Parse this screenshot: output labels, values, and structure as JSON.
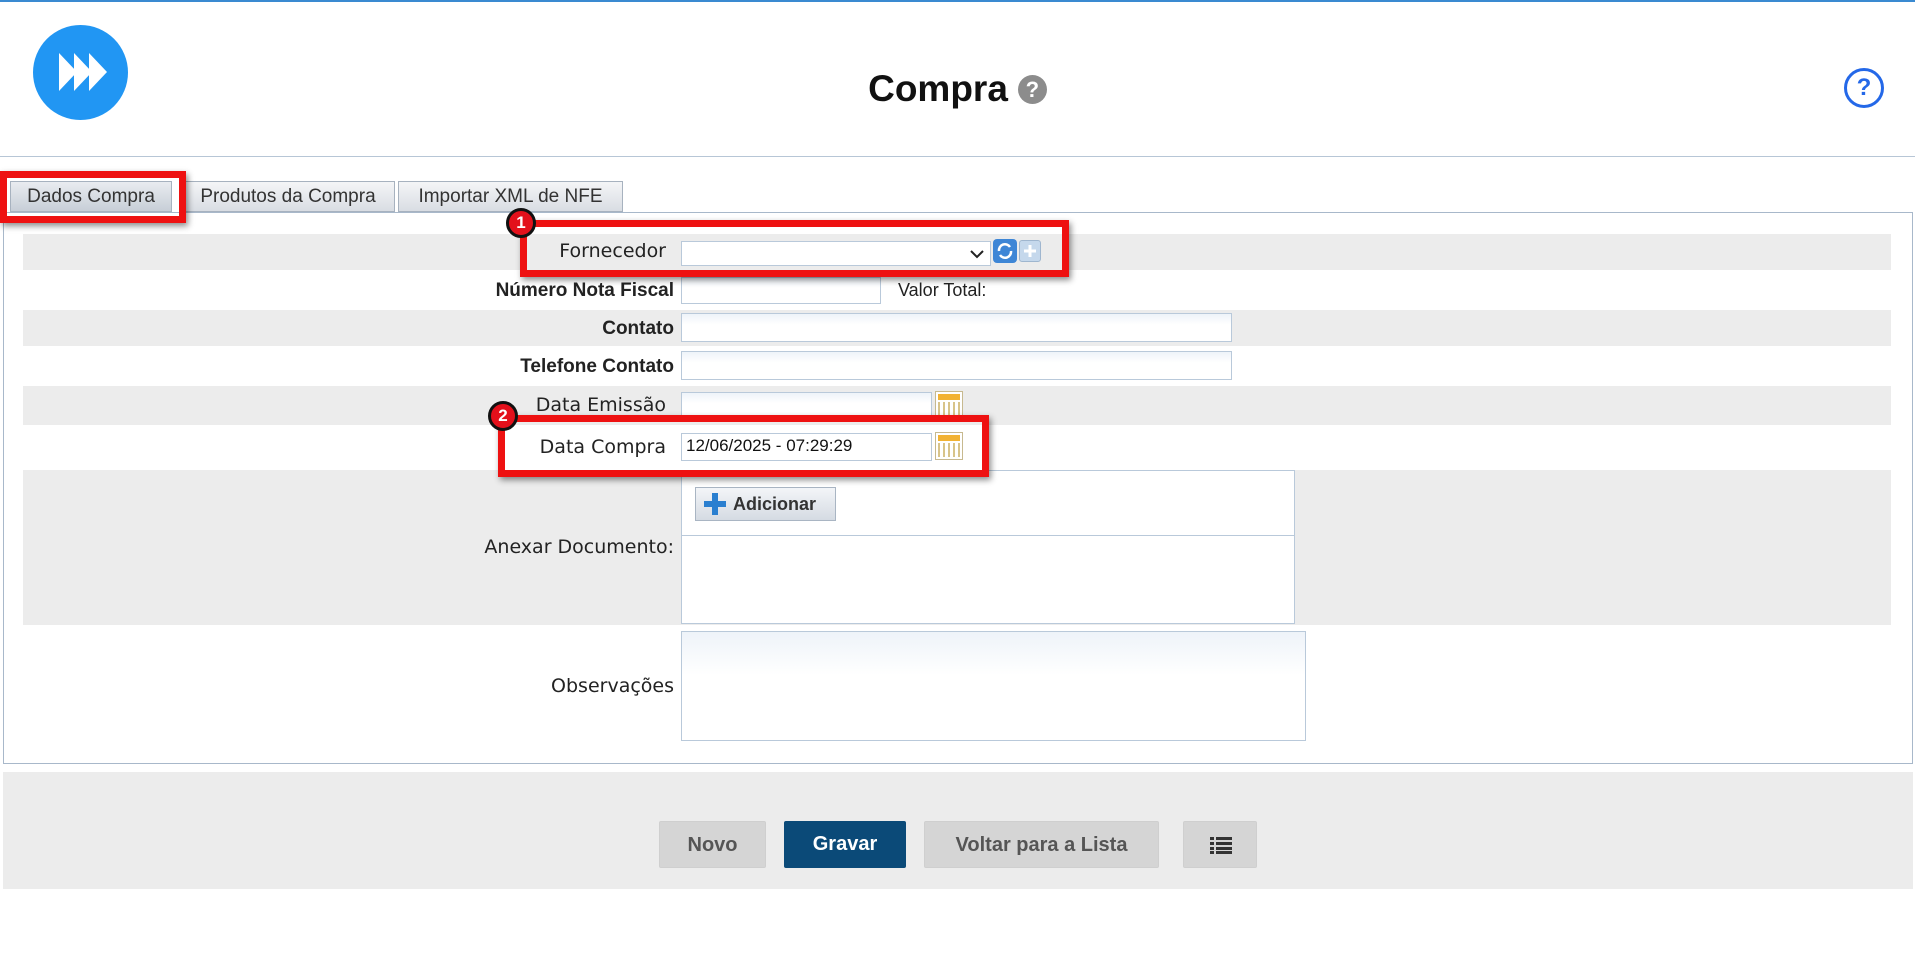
{
  "header": {
    "title": "Compra",
    "title_help_icon": "?",
    "help_icon": "?"
  },
  "tabs": [
    {
      "label": "Dados Compra",
      "active": true
    },
    {
      "label": "Produtos da Compra",
      "active": false
    },
    {
      "label": "Importar XML de NFE",
      "active": false
    }
  ],
  "form": {
    "fornecedor_label": "Fornecedor",
    "fornecedor_value": "",
    "numero_nota_label": "Número Nota Fiscal",
    "numero_nota_value": "",
    "valor_total_label": "Valor Total:",
    "contato_label": "Contato",
    "contato_value": "",
    "telefone_label": "Telefone Contato",
    "telefone_value": "",
    "data_emissao_label": "Data Emissão",
    "data_emissao_value": "",
    "data_compra_label": "Data Compra",
    "data_compra_value": "12/06/2025 - 07:29:29",
    "anexar_label": "Anexar Documento:",
    "adicionar_label": "Adicionar",
    "observacoes_label": "Observações",
    "observacoes_value": ""
  },
  "footer": {
    "novo": "Novo",
    "gravar": "Gravar",
    "voltar": "Voltar para a Lista"
  },
  "annotations": {
    "badge_1": "1",
    "badge_2": "2"
  },
  "colors": {
    "accent": "#2196f3",
    "primary_button": "#0b4a78",
    "highlight": "#ee1111"
  },
  "icons": [
    "logo-fast-forward-icon",
    "question-icon",
    "help-circle-icon",
    "chevron-down-icon",
    "refresh-icon",
    "add-icon",
    "calendar-icon",
    "plus-icon",
    "list-icon"
  ]
}
